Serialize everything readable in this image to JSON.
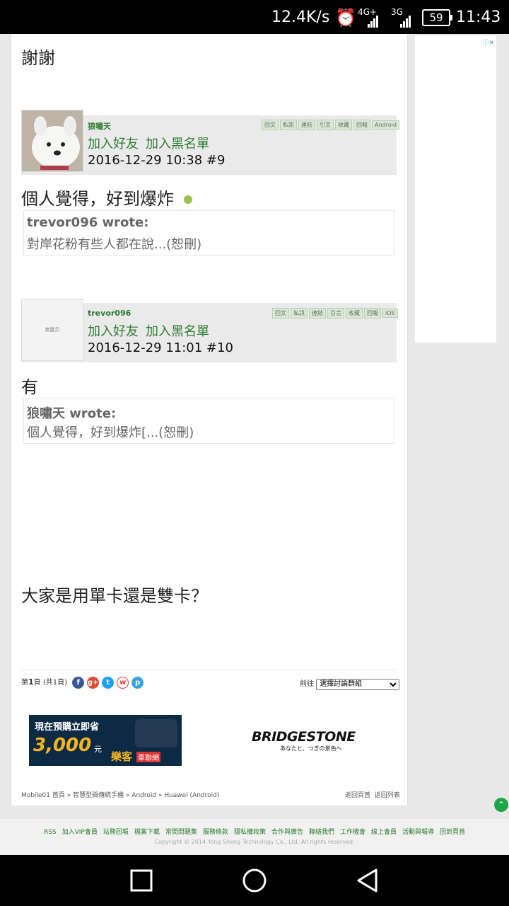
{
  "status": {
    "net_speed": "12.4K/s",
    "sig1": "4G+",
    "sig2": "3G",
    "battery": "59",
    "time": "11:43"
  },
  "thread": {
    "prev_tail": "謝謝",
    "posts": [
      {
        "username": "狼嘯天",
        "add_friend": "加入好友",
        "add_block": "加入黑名單",
        "datetime": "2016-12-29 10:38  #9",
        "tags": [
          "回文",
          "私訊",
          "連結",
          "引言",
          "收藏",
          "回報",
          "Android"
        ],
        "body": "個人覺得，好到爆炸",
        "quote_author": "trevor096 wrote:",
        "quote_text": "對岸花粉有些人都在說...(恕刪)"
      },
      {
        "username": "trevor096",
        "avatar_text": "無圖示",
        "add_friend": "加入好友",
        "add_block": "加入黑名單",
        "datetime": "2016-12-29 11:01  #10",
        "tags": [
          "回文",
          "私訊",
          "連結",
          "引言",
          "收藏",
          "回報",
          "iOS"
        ],
        "body": "有",
        "quote_author": "狼嘯天 wrote:",
        "quote_text": "個人覺得，好到爆炸[...(恕刪)",
        "extra": "大家是用單卡還是雙卡？"
      }
    ]
  },
  "pager": {
    "pre": "第",
    "page": "1",
    "post": "頁 (共1頁)",
    "goto_label": "前往",
    "goto_select": "選擇討論群組"
  },
  "ads": {
    "left_line1": "現在預購立即省",
    "left_amount": "3,000",
    "left_unit": "元",
    "left_brand": "樂客",
    "left_brand2": "車聯網",
    "right_brand": "BRIDGESTONE",
    "right_slogan": "あなたと、つぎの景色へ"
  },
  "breadcrumb": {
    "text": "Mobile01 首頁 » 智慧型與傳統手機 » Android » Huawei (Android)",
    "back_home": "返回頁首",
    "back_list": "返回列表"
  },
  "footer": {
    "links": [
      "RSS",
      "加入VIP會員",
      "站務回報",
      "檔案下載",
      "常問問題集",
      "服務條款",
      "隱私權政策",
      "合作與廣告",
      "聯絡我們",
      "工作機會",
      "線上會員",
      "活動與報導",
      "回到頁首"
    ],
    "copyright": "Copyright © 2014 Yong Sheng Technology Co., Ltd. All rights reserved."
  },
  "colors": {
    "accent": "#2e7d32",
    "tag_bg": "#d9e8d4"
  }
}
